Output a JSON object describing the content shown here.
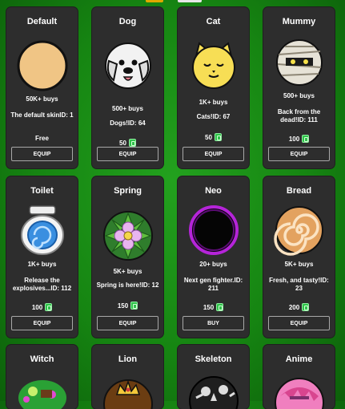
{
  "coin_color": "#2fc24a",
  "cards": [
    {
      "name": "Default",
      "buys": "50K+ buys",
      "desc": "The default skinID: 1",
      "price": "Free",
      "button": "EQUIP",
      "icon": "plain-circle-icon"
    },
    {
      "name": "Dog",
      "buys": "500+ buys",
      "desc": "Dogs!ID: 64",
      "price": "50",
      "button": "EQUIP",
      "icon": "dog-face-icon"
    },
    {
      "name": "Cat",
      "buys": "1K+ buys",
      "desc": "Cats!ID: 67",
      "price": "50",
      "button": "EQUIP",
      "icon": "cat-face-icon"
    },
    {
      "name": "Mummy",
      "buys": "500+ buys",
      "desc": "Back from the dead!ID: 111",
      "price": "100",
      "button": "EQUIP",
      "icon": "mummy-face-icon"
    },
    {
      "name": "Toilet",
      "buys": "1K+ buys",
      "desc": "Release the explosives...ID: 112",
      "price": "100",
      "button": "EQUIP",
      "icon": "toilet-icon"
    },
    {
      "name": "Spring",
      "buys": "5K+ buys",
      "desc": "Spring is here!ID: 12",
      "price": "150",
      "button": "EQUIP",
      "icon": "flower-icon"
    },
    {
      "name": "Neo",
      "buys": "20+ buys",
      "desc": "Next gen fighter.ID: 211",
      "price": "150",
      "button": "BUY",
      "icon": "dark-orb-icon"
    },
    {
      "name": "Bread",
      "buys": "5K+ buys",
      "desc": "Fresh, and tasty!ID: 23",
      "price": "200",
      "button": "EQUIP",
      "icon": "cinnamon-roll-icon"
    },
    {
      "name": "Witch",
      "icon": "witch-icon"
    },
    {
      "name": "Lion",
      "icon": "lion-icon"
    },
    {
      "name": "Skeleton",
      "icon": "skeleton-icon"
    },
    {
      "name": "Anime",
      "icon": "anime-face-icon"
    }
  ]
}
